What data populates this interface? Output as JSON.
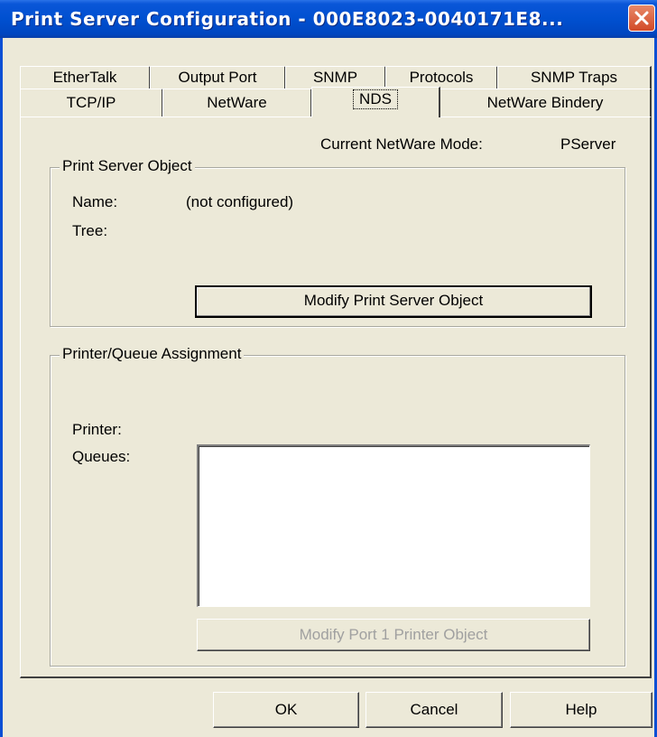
{
  "window": {
    "title": "Print Server Configuration - 000E8023-0040171E8...",
    "close_icon": "close-icon"
  },
  "tabs": {
    "row1": [
      "EtherTalk",
      "Output Port",
      "SNMP",
      "Protocols",
      "SNMP Traps"
    ],
    "row2": [
      "TCP/IP",
      "NetWare",
      "NDS",
      "NetWare Bindery"
    ],
    "active": "NDS"
  },
  "nds": {
    "mode_label": "Current NetWare Mode:",
    "mode_value": "PServer",
    "print_server_object": {
      "legend": "Print Server Object",
      "name_label": "Name:",
      "name_value": "(not configured)",
      "tree_label": "Tree:",
      "tree_value": "",
      "modify_button": "Modify Print Server Object"
    },
    "printer_queue": {
      "legend": "Printer/Queue Assignment",
      "printer_label": "Printer:",
      "printer_value": "",
      "queues_label": "Queues:",
      "queues": [],
      "modify_button": "Modify Port 1 Printer Object",
      "modify_button_enabled": false
    }
  },
  "footer": {
    "ok": "OK",
    "cancel": "Cancel",
    "help": "Help"
  },
  "colors": {
    "titlebar": "#0050D0",
    "face": "#ECE9D8",
    "close": "#D24A28"
  }
}
